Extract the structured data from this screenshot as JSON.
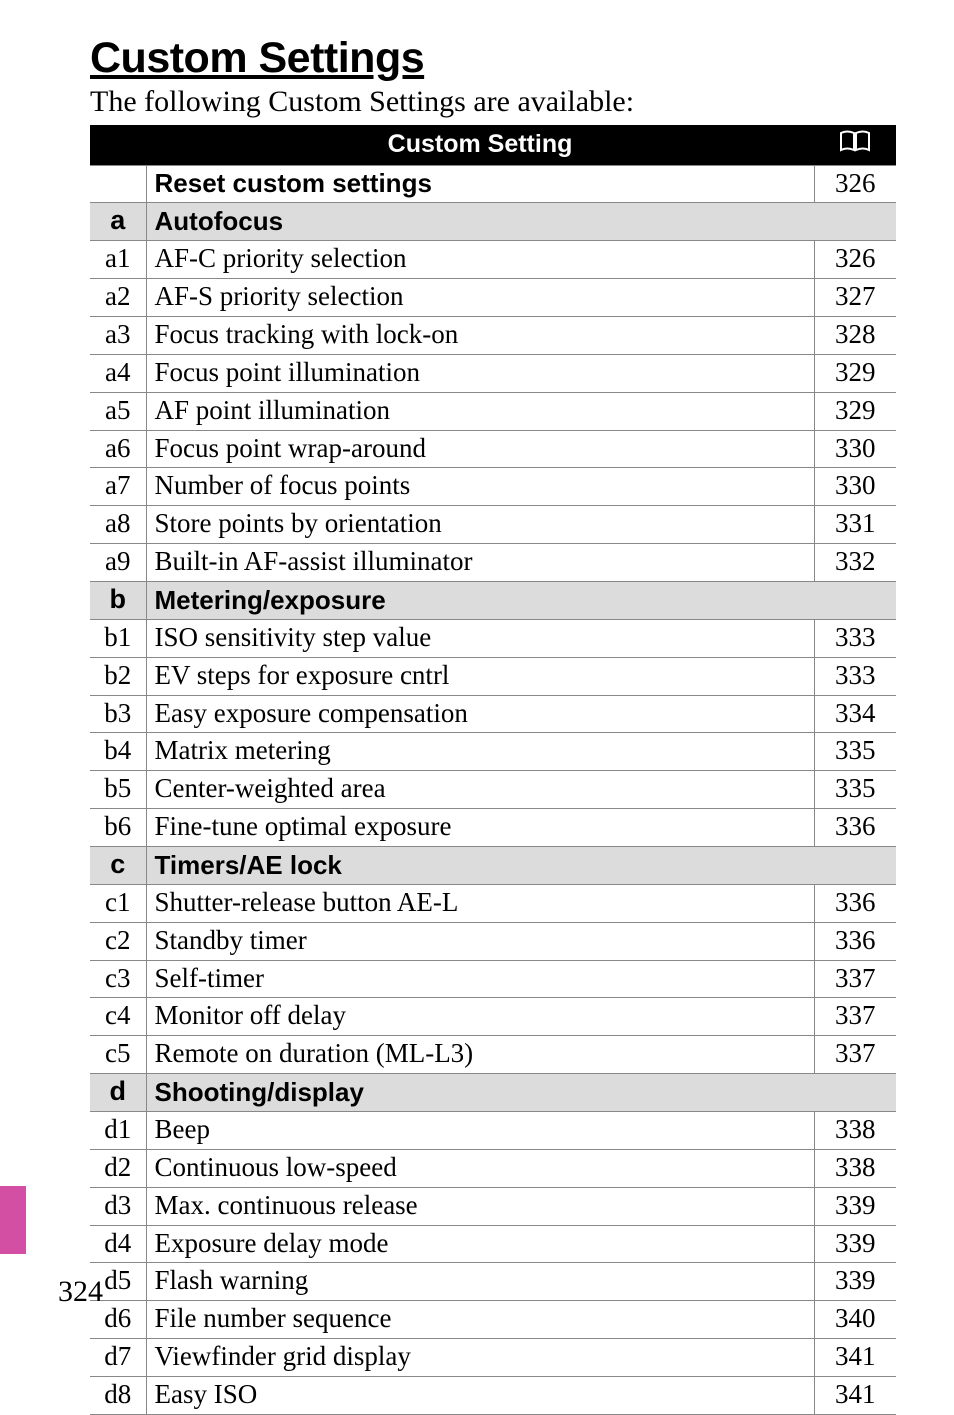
{
  "title": "Custom Settings",
  "intro": "The following Custom Settings are available:",
  "header": {
    "label": "Custom Setting"
  },
  "reset": {
    "label": "Reset custom settings",
    "page": "326"
  },
  "sections": [
    {
      "code": "a",
      "label": "Autofocus",
      "rows": [
        {
          "code": "a1",
          "label": "AF-C priority selection",
          "page": "326"
        },
        {
          "code": "a2",
          "label": "AF-S priority selection",
          "page": "327"
        },
        {
          "code": "a3",
          "label": "Focus tracking with lock-on",
          "page": "328"
        },
        {
          "code": "a4",
          "label": "Focus point illumination",
          "page": "329"
        },
        {
          "code": "a5",
          "label": "AF point illumination",
          "page": "329"
        },
        {
          "code": "a6",
          "label": "Focus point wrap-around",
          "page": "330"
        },
        {
          "code": "a7",
          "label": "Number of focus points",
          "page": "330"
        },
        {
          "code": "a8",
          "label": "Store points by orientation",
          "page": "331"
        },
        {
          "code": "a9",
          "label": "Built-in AF-assist illuminator",
          "page": "332"
        }
      ]
    },
    {
      "code": "b",
      "label": "Metering/exposure",
      "rows": [
        {
          "code": "b1",
          "label": "ISO sensitivity step value",
          "page": "333"
        },
        {
          "code": "b2",
          "label": "EV steps for exposure cntrl",
          "page": "333"
        },
        {
          "code": "b3",
          "label": "Easy exposure compensation",
          "page": "334"
        },
        {
          "code": "b4",
          "label": "Matrix metering",
          "page": "335"
        },
        {
          "code": "b5",
          "label": "Center-weighted area",
          "page": "335"
        },
        {
          "code": "b6",
          "label": "Fine-tune optimal exposure",
          "page": "336"
        }
      ]
    },
    {
      "code": "c",
      "label": "Timers/AE lock",
      "rows": [
        {
          "code": "c1",
          "label": "Shutter-release button AE-L",
          "page": "336"
        },
        {
          "code": "c2",
          "label": "Standby timer",
          "page": "336"
        },
        {
          "code": "c3",
          "label": "Self-timer",
          "page": "337"
        },
        {
          "code": "c4",
          "label": "Monitor off delay",
          "page": "337"
        },
        {
          "code": "c5",
          "label": "Remote on duration (ML-L3)",
          "page": "337"
        }
      ]
    },
    {
      "code": "d",
      "label": "Shooting/display",
      "rows": [
        {
          "code": "d1",
          "label": "Beep",
          "page": "338"
        },
        {
          "code": "d2",
          "label": "Continuous low-speed",
          "page": "338"
        },
        {
          "code": "d3",
          "label": "Max.  continuous release",
          "page": "339"
        },
        {
          "code": "d4",
          "label": "Exposure delay mode",
          "page": "339"
        },
        {
          "code": "d5",
          "label": "Flash warning",
          "page": "339"
        },
        {
          "code": "d6",
          "label": "File number sequence",
          "page": "340"
        },
        {
          "code": "d7",
          "label": "Viewfinder grid display",
          "page": "341"
        },
        {
          "code": "d8",
          "label": "Easy ISO",
          "page": "341"
        }
      ]
    }
  ],
  "page_number": "324"
}
